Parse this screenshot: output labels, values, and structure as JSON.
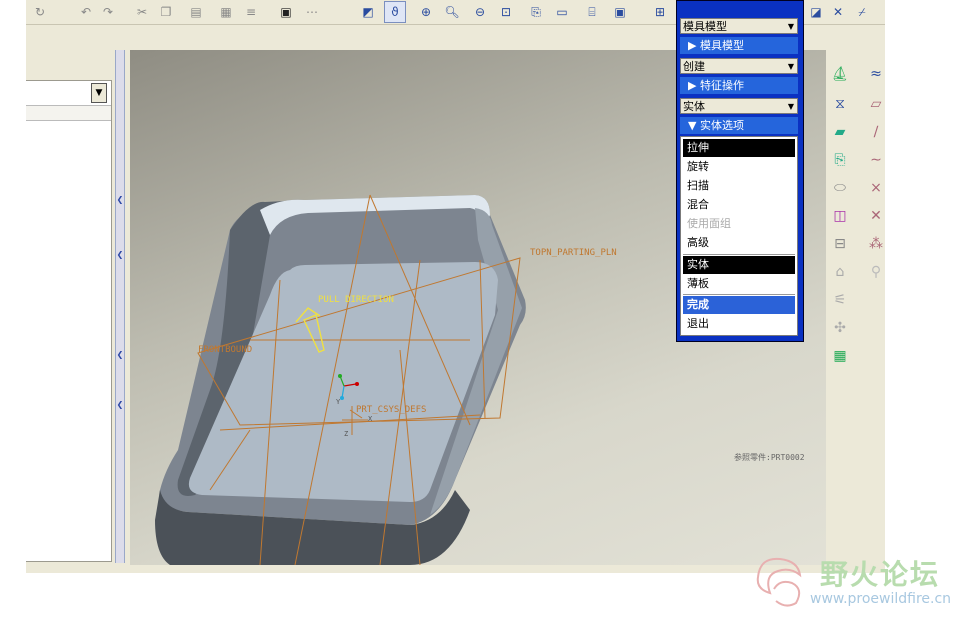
{
  "left_panel": {
    "dropdown_caret": "▼"
  },
  "menu": {
    "top_dropdown": "模具模型",
    "header_mold_model": "模具模型",
    "create_dropdown": "创建",
    "header_feature_ops": "特征操作",
    "solid_dropdown": "实体",
    "header_solid_options": "实体选项",
    "solid_options": [
      "拉伸",
      "旋转",
      "扫描",
      "混合",
      "使用面组",
      "高级"
    ],
    "solid_thin": [
      "实体",
      "薄板"
    ],
    "actions": [
      "完成",
      "退出"
    ]
  },
  "viewport": {
    "label_parting_plane": "TOPN_PARTING_PLN",
    "label_pull_direction": "PULL DIRECTION",
    "label_front": "FRONTBOUND",
    "label_csys": "PRT_CSYS_DEFS",
    "label_part": "参照零件:PRT0002",
    "csys_x": "X",
    "csys_y": "Y",
    "csys_z": "Z"
  },
  "watermark": {
    "title": "野火论坛",
    "url": "www.proewildfire.cn"
  },
  "colors": {
    "menu_bg": "#0a31c2",
    "menu_header": "#2565dc",
    "datum": "#c07830",
    "label_yellow": "#f0e040",
    "surface": "#aebac6"
  }
}
